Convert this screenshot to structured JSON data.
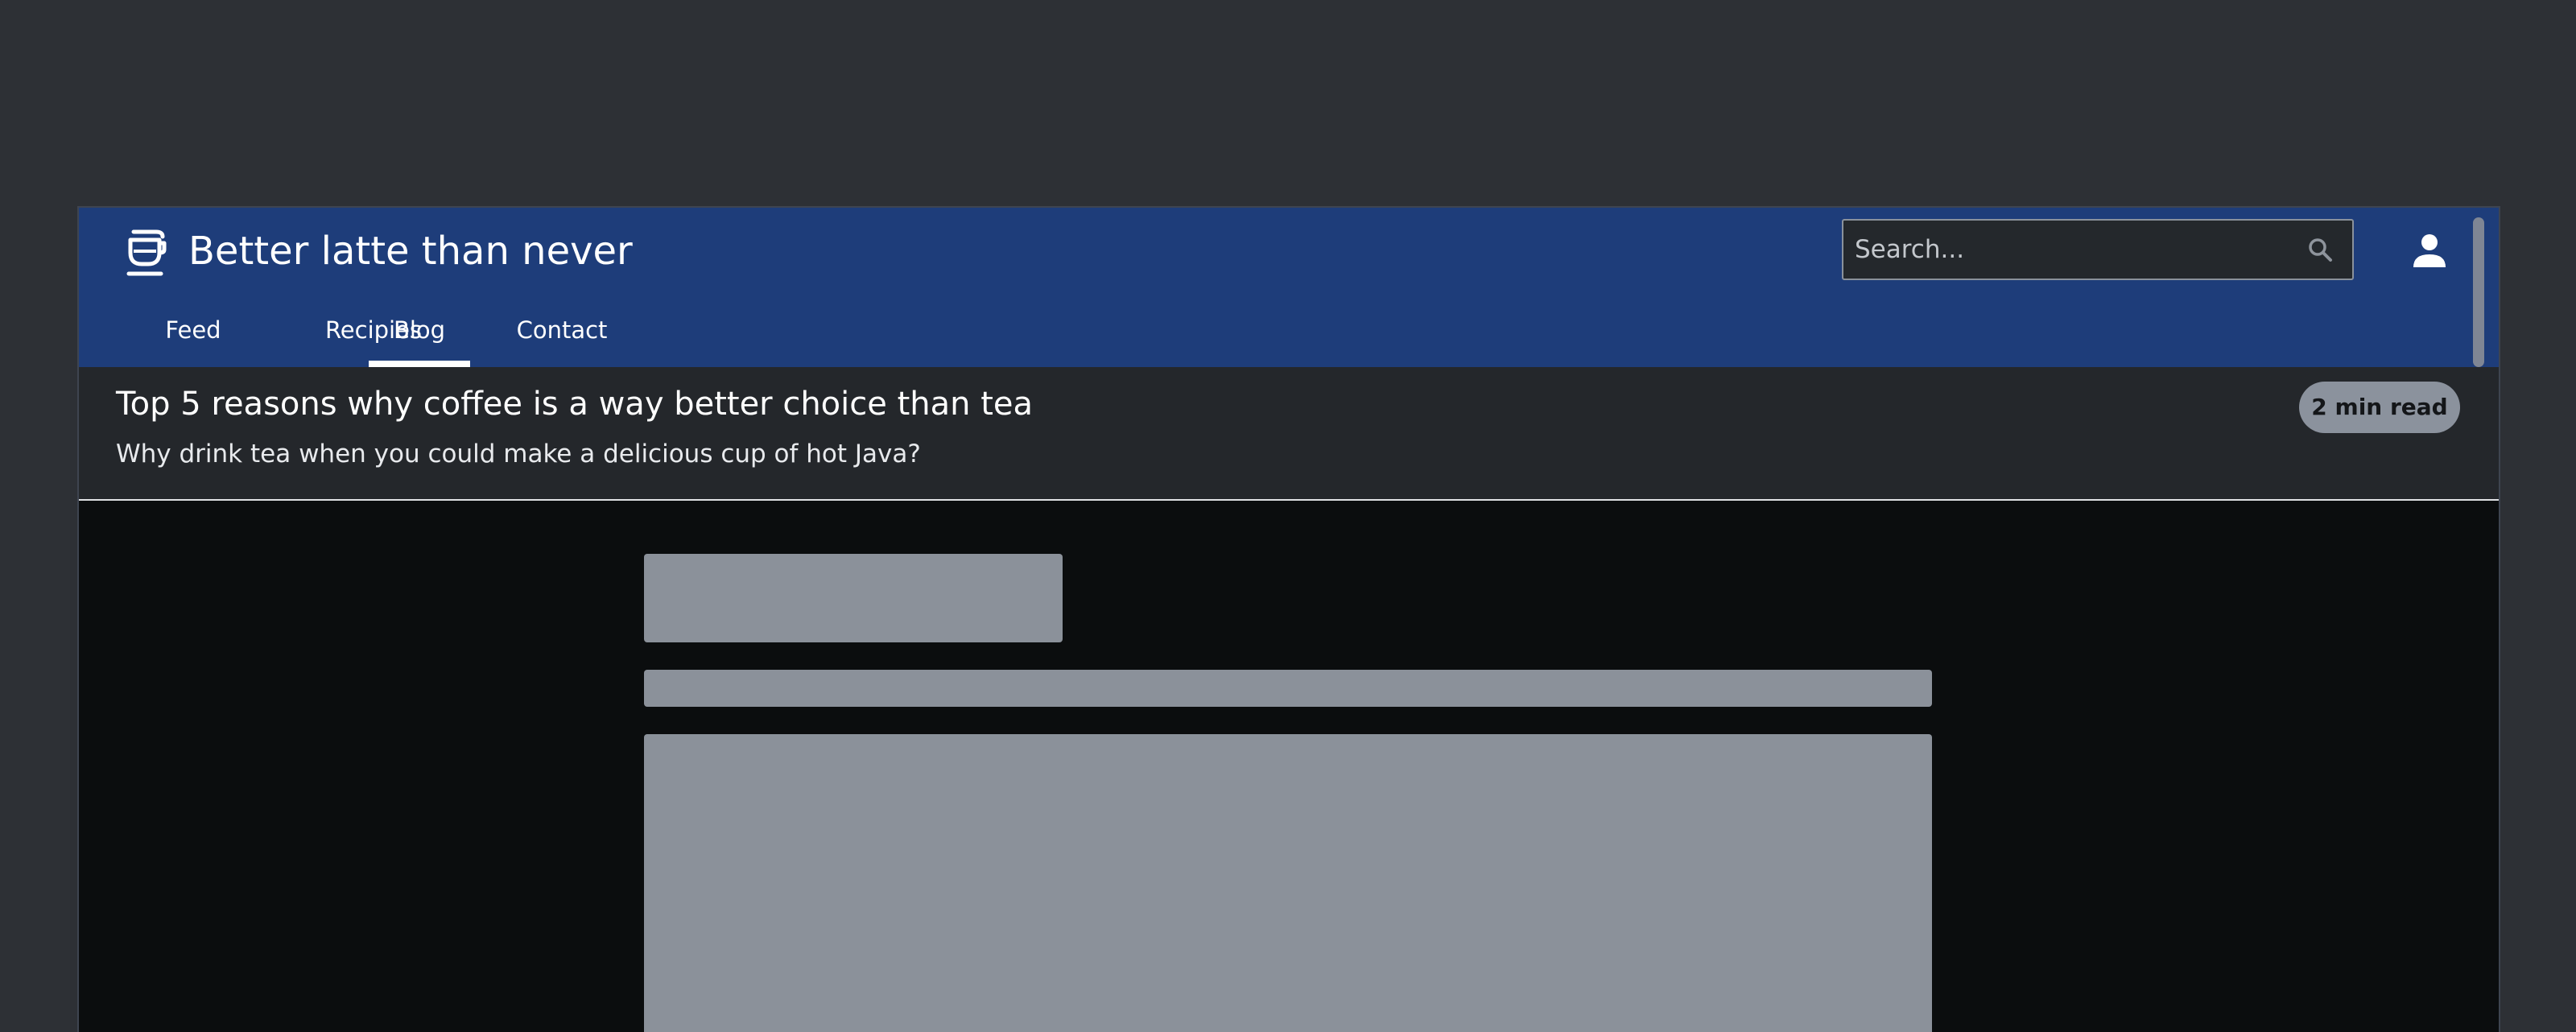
{
  "header": {
    "site_title": "Better latte than never",
    "logo_icon": "coffee-cup-icon",
    "brand_color": "#1e3d7a"
  },
  "search": {
    "placeholder": "Search...",
    "icon": "search-icon"
  },
  "user": {
    "icon": "user-icon"
  },
  "tabs": [
    {
      "label": "Feed",
      "active": false
    },
    {
      "label": "Recipies",
      "active": false
    },
    {
      "label": "Blog",
      "active": true
    },
    {
      "label": "Contact",
      "active": false
    }
  ],
  "post": {
    "title": "Top 5 reasons why coffee is a way better choice than tea",
    "subtitle": "Why drink tea when you could make a delicious cup of hot Java?",
    "read_time": "2 min read"
  }
}
